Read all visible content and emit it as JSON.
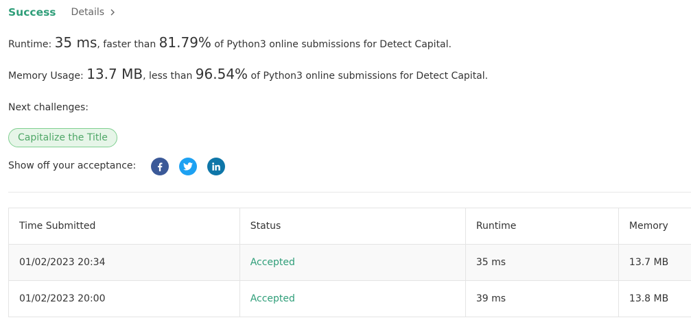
{
  "header": {
    "status": "Success",
    "details_label": "Details"
  },
  "runtime": {
    "label": "Runtime:",
    "value": "35 ms",
    "comparison": ", faster than",
    "percent": "81.79%",
    "suffix": "of Python3 online submissions for Detect Capital."
  },
  "memory": {
    "label": "Memory Usage:",
    "value": "13.7 MB",
    "comparison": ", less than",
    "percent": "96.54%",
    "suffix": "of Python3 online submissions for Detect Capital."
  },
  "next": {
    "label": "Next challenges:",
    "challenges": [
      "Capitalize the Title"
    ]
  },
  "share": {
    "label": "Show off your acceptance:",
    "icons": [
      "facebook-icon",
      "twitter-icon",
      "linkedin-icon"
    ],
    "colors": {
      "facebook": "#3b5998",
      "twitter": "#1da1f2",
      "linkedin": "#0e76a8"
    }
  },
  "table": {
    "headers": [
      "Time Submitted",
      "Status",
      "Runtime",
      "Memory"
    ],
    "rows": [
      {
        "time": "01/02/2023 20:34",
        "status": "Accepted",
        "runtime": "35 ms",
        "memory": "13.7 MB"
      },
      {
        "time": "01/02/2023 20:00",
        "status": "Accepted",
        "runtime": "39 ms",
        "memory": "13.8 MB"
      }
    ]
  },
  "colors": {
    "accent": "#2f9e79",
    "pill_background": "#e6f5e8",
    "pill_border": "#7fcf90"
  }
}
